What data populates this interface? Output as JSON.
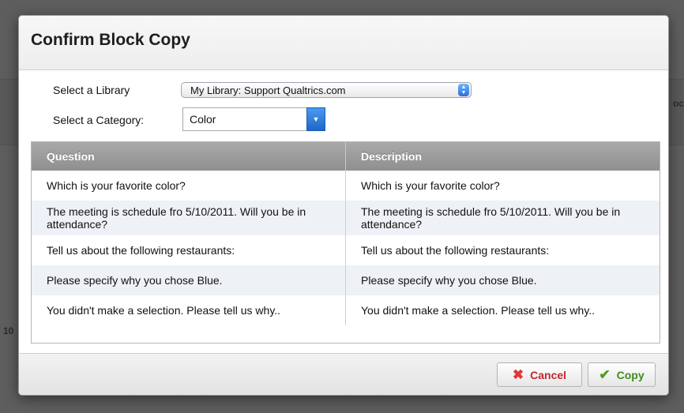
{
  "background": {
    "fragment_right": "oc",
    "fragment_left": "10"
  },
  "dialog": {
    "title": "Confirm Block Copy",
    "library": {
      "label": "Select a Library",
      "value": "My Library: Support Qualtrics.com"
    },
    "category": {
      "label": "Select a Category:",
      "value": "Color"
    },
    "table": {
      "headers": [
        "Question",
        "Description"
      ],
      "rows": [
        {
          "question": "Which is your favorite color?",
          "description": "Which is your favorite color?"
        },
        {
          "question": "The meeting is schedule fro 5/10/2011. Will you be in attendance?",
          "description": "The meeting is schedule fro 5/10/2011. Will you be in attendance?"
        },
        {
          "question": "Tell us about the following restaurants:",
          "description": "Tell us about the following restaurants:"
        },
        {
          "question": "Please specify why you chose Blue.",
          "description": "Please specify why you chose Blue."
        },
        {
          "question": "You didn't make a selection. Please tell us why..",
          "description": "You didn't make a selection. Please tell us why.."
        }
      ]
    },
    "buttons": {
      "cancel": "Cancel",
      "copy": "Copy"
    }
  },
  "colors": {
    "header_gray": "#999999",
    "cancel_red": "#c0282e",
    "copy_green": "#3e8d1e",
    "select_blue": "#2a6fd6"
  },
  "icons": {
    "cancel": "x-icon",
    "copy": "checkmark-icon",
    "library_select": "stepper-arrows-icon",
    "category_select": "chevron-down-icon"
  }
}
